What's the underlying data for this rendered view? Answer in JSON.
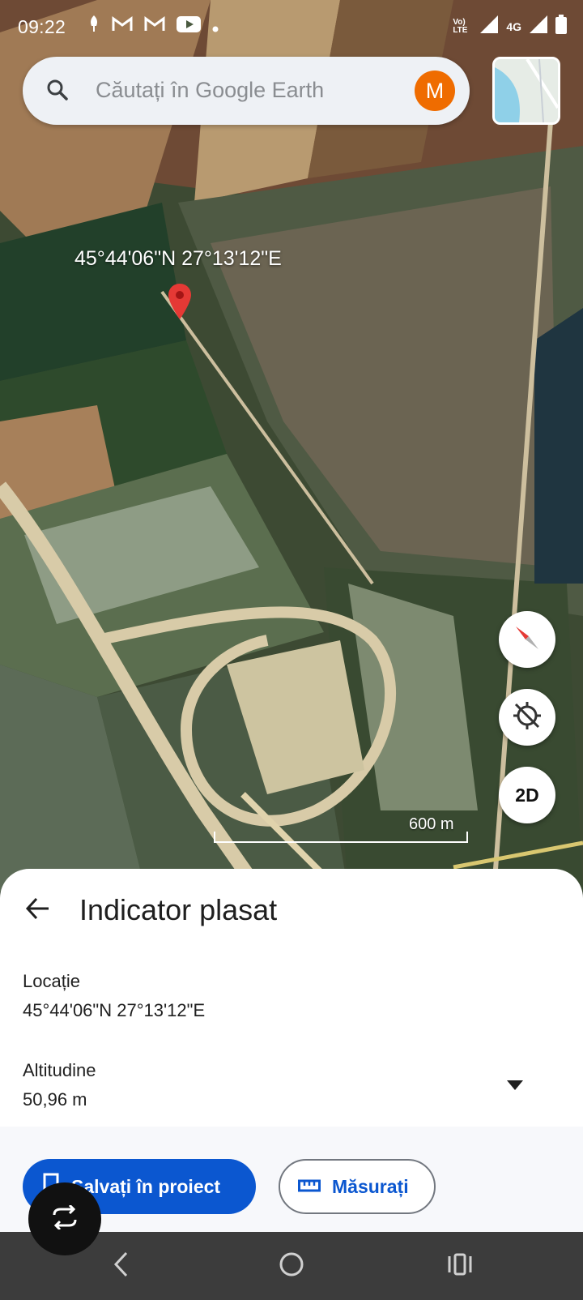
{
  "status_bar": {
    "time": "09:22",
    "network": "4G",
    "volte": "Vo) LTE"
  },
  "search": {
    "placeholder": "Căutați în Google Earth",
    "avatar_letter": "M"
  },
  "map": {
    "pin_coordinates": "45°44'06\"N 27°13'12\"E",
    "scale_label": "600 m",
    "view_toggle": "2D"
  },
  "sheet": {
    "title": "Indicator plasat",
    "location_label": "Locație",
    "location_value": "45°44'06\"N 27°13'12\"E",
    "altitude_label": "Altitudine",
    "altitude_value": "50,96 m",
    "save_button": "Salvați în proiect",
    "measure_button": "Măsurați"
  },
  "colors": {
    "primary": "#0b57d0",
    "avatar": "#ef6c00",
    "pin": "#e53935"
  }
}
